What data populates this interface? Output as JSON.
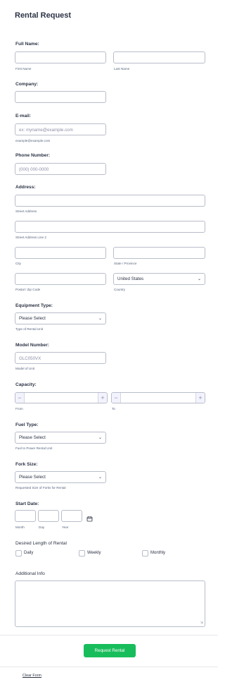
{
  "form": {
    "title": "Rental Request",
    "full_name": {
      "label": "Full Name:",
      "first_value": "",
      "first_sub": "First Name",
      "last_value": "",
      "last_sub": "Last Name"
    },
    "company": {
      "label": "Company:",
      "value": ""
    },
    "email": {
      "label": "E-mail:",
      "placeholder": "ex: myname@example.com",
      "sub": "example@example.com"
    },
    "phone": {
      "label": "Phone Number:",
      "placeholder": "(000) 000-0000"
    },
    "address": {
      "label": "Address:",
      "street_sub": "Street Address",
      "street2_sub": "Street Address Line 2",
      "city_sub": "City",
      "state_sub": "State / Province",
      "postal_sub": "Postal / Zip Code",
      "country_value": "United States",
      "country_sub": "Country"
    },
    "equipment_type": {
      "label": "Equipment Type:",
      "value": "Please Select",
      "sub": "Type of Rental Unit"
    },
    "model_number": {
      "label": "Model Number:",
      "placeholder": "GLC050VX",
      "sub": "Model of Unit"
    },
    "capacity": {
      "label": "Capacity:",
      "from_sub": "From",
      "to_sub": "To",
      "minus": "−",
      "plus": "+"
    },
    "fuel_type": {
      "label": "Fuel Type:",
      "value": "Please Select",
      "sub": "Fuel to Power Rental Unit"
    },
    "fork_size": {
      "label": "Fork Size:",
      "value": "Please Select",
      "sub": "Requested Size of Forks for Rental"
    },
    "start_date": {
      "label": "Start Date:",
      "month_sub": "Month",
      "day_sub": "Day",
      "year_sub": "Year"
    },
    "length": {
      "label": "Desired Length of Rental",
      "options": [
        "Daily",
        "Weekly",
        "Monthly"
      ]
    },
    "additional_info": {
      "label": "Additional Info"
    },
    "submit_label": "Request Rental",
    "clear_label": "Clear Form"
  },
  "icons": {
    "chevron": "chevron-down-icon",
    "calendar": "calendar-icon"
  },
  "colors": {
    "submit_button": "#18bd5b",
    "text": "#2c3345",
    "border": "#b8bdc9"
  }
}
